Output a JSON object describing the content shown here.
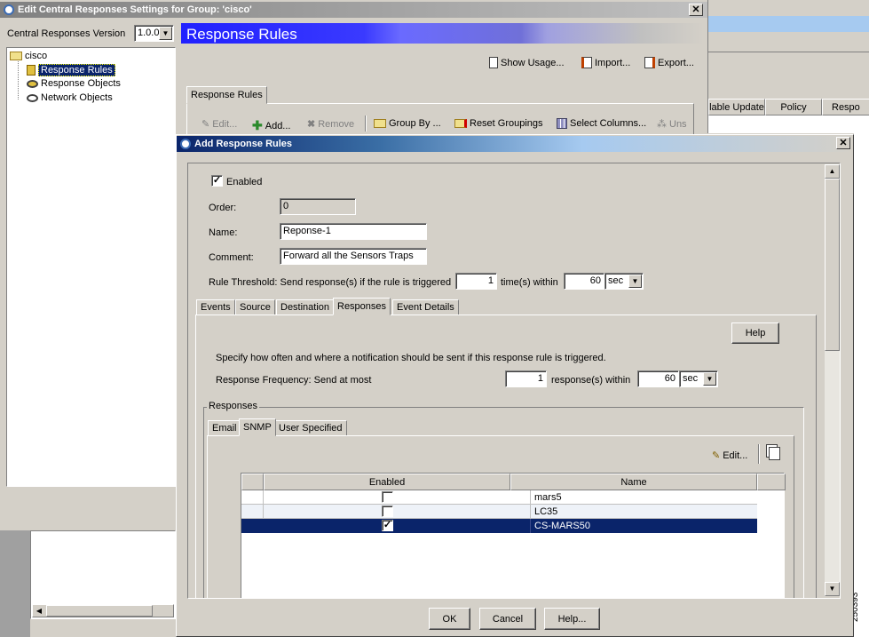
{
  "back_window": {
    "title": "Edit Central Responses Settings for Group: 'cisco'",
    "version_label": "Central Responses Version",
    "version_value": "1.0.0",
    "tree": {
      "root": "cisco",
      "items": [
        "Response Rules",
        "Response Objects",
        "Network Objects"
      ]
    },
    "banner_title": "Response Rules",
    "top_actions": [
      "Show Usage...",
      "Import...",
      "Export..."
    ],
    "tab_label": "Response Rules",
    "toolbar": [
      "Edit...",
      "Add...",
      "Remove",
      "Group By ...",
      "Reset Groupings",
      "Select Columns...",
      "Uns"
    ]
  },
  "far_table": {
    "headers": [
      "lable Update",
      "Policy",
      "Respo"
    ]
  },
  "dialog": {
    "title": "Add Response Rules",
    "enabled_label": "Enabled",
    "order_label": "Order:",
    "order_value": "0",
    "name_label": "Name:",
    "name_value": "Reponse-1",
    "comment_label": "Comment:",
    "comment_value": "Forward all the Sensors Traps",
    "threshold_label": "Rule Threshold: Send response(s) if the rule is triggered",
    "threshold_count": "1",
    "threshold_within": "time(s) within",
    "threshold_time": "60",
    "threshold_unit": "sec",
    "tabs": [
      "Events",
      "Source",
      "Destination",
      "Responses",
      "Event Details"
    ],
    "help_button": "Help",
    "description": "Specify how often and where a notification should be sent if this response rule is triggered.",
    "freq_label": "Response Frequency: Send at most",
    "freq_count": "1",
    "freq_within": "response(s) within",
    "freq_time": "60",
    "freq_unit": "sec",
    "group_label": "Responses",
    "inner_tabs": [
      "Email",
      "SNMP",
      "User Specified"
    ],
    "edit_button": "Edit...",
    "table_headers": [
      "Enabled",
      "Name"
    ],
    "rows": [
      {
        "enabled": false,
        "name": "mars5"
      },
      {
        "enabled": false,
        "name": "LC35"
      },
      {
        "enabled": true,
        "name": "CS-MARS50"
      }
    ],
    "ok": "OK",
    "cancel": "Cancel",
    "help": "Help..."
  },
  "figure_id": "250393",
  "colors": {
    "title_active": "#0a246a",
    "banner": "#3c3cff",
    "selection": "#0a246a"
  }
}
